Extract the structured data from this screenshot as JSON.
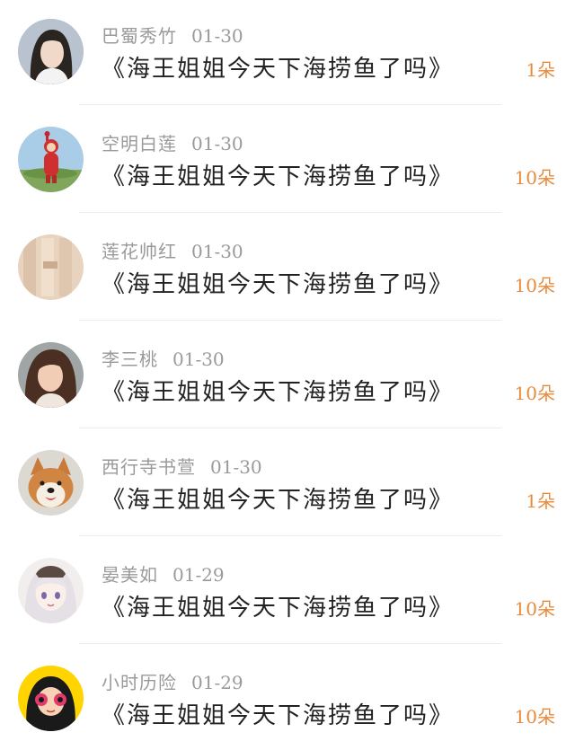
{
  "comments": [
    {
      "user": "巴蜀秀竹",
      "date": "01-30",
      "title": "《海王姐姐今天下海捞鱼了吗》",
      "count": "1朵",
      "avatar": "woman-portrait-avatar"
    },
    {
      "user": "空明白莲",
      "date": "01-30",
      "title": "《海王姐姐今天下海捞鱼了吗》",
      "count": "10朵",
      "avatar": "red-teletubby-avatar"
    },
    {
      "user": "莲花帅红",
      "date": "01-30",
      "title": "《海王姐姐今天下海捞鱼了吗》",
      "count": "10朵",
      "avatar": "beige-fabric-avatar"
    },
    {
      "user": "李三桃",
      "date": "01-30",
      "title": "《海王姐姐今天下海捞鱼了吗》",
      "count": "10朵",
      "avatar": "woman-portrait-avatar"
    },
    {
      "user": "西行寺书萱",
      "date": "01-30",
      "title": "《海王姐姐今天下海捞鱼了吗》",
      "count": "1朵",
      "avatar": "shiba-dog-avatar"
    },
    {
      "user": "晏美如",
      "date": "01-29",
      "title": "《海王姐姐今天下海捞鱼了吗》",
      "count": "10朵",
      "avatar": "anime-girl-avatar"
    },
    {
      "user": "小时历险",
      "date": "01-29",
      "title": "《海王姐姐今天下海捞鱼了吗》",
      "count": "10朵",
      "avatar": "cartoon-girl-avatar"
    }
  ],
  "colors": {
    "username": "#9a9a9a",
    "title": "#222222",
    "count": "#e88b3a",
    "divider": "#ececec"
  }
}
